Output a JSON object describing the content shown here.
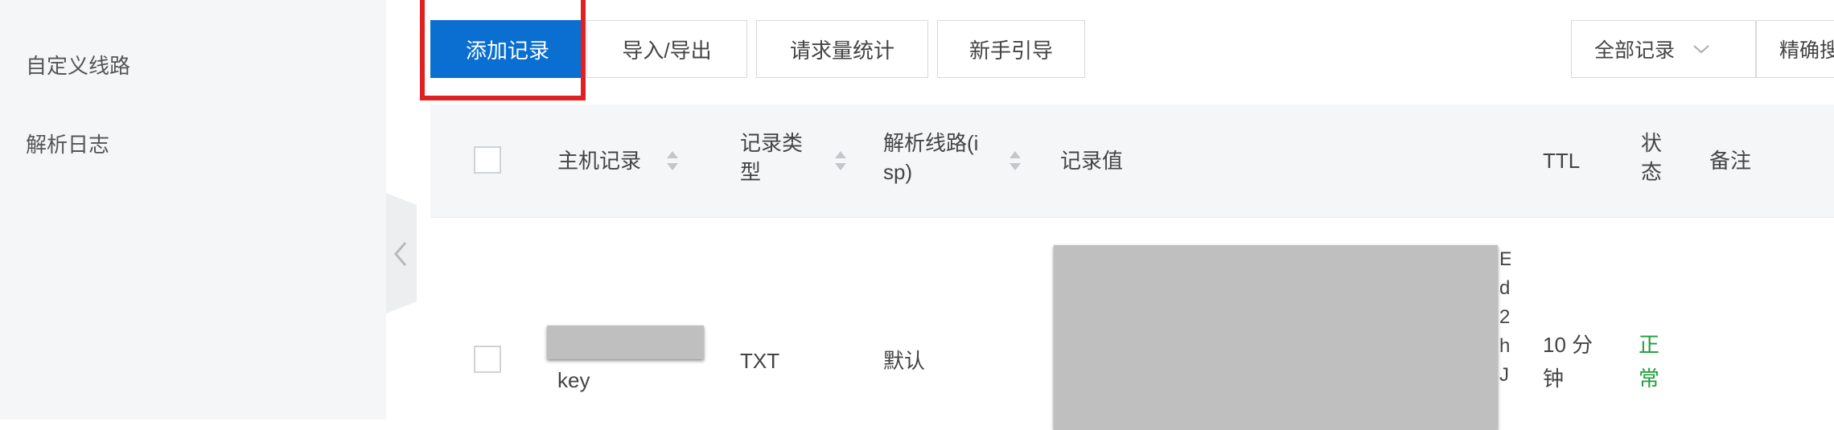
{
  "sidebar": {
    "items": [
      {
        "label": "自定义线路"
      },
      {
        "label": "解析日志"
      }
    ]
  },
  "toolbar": {
    "add_record": "添加记录",
    "import_export": "导入/导出",
    "request_stats": "请求量统计",
    "guide": "新手引导",
    "filter_select": "全部记录",
    "search_mode": "精确搜"
  },
  "table": {
    "headers": {
      "host": "主机记录",
      "type_l1": "记录类",
      "type_l2": "型",
      "line_l1": "解析线路(i",
      "line_l2": "sp)",
      "value": "记录值",
      "ttl": "TTL",
      "status_l1": "状",
      "status_l2": "态",
      "remark": "备注"
    },
    "rows": [
      {
        "host_suffix": "key",
        "type": "TXT",
        "line": "默认",
        "value_tail": [
          "E",
          "d",
          "2",
          "h",
          "J"
        ],
        "ttl_l1": "10 分",
        "ttl_l2": "钟",
        "status_l1": "正",
        "status_l2": "常"
      }
    ]
  },
  "colors": {
    "primary": "#0a6fd1",
    "highlight": "#e02121",
    "status_ok": "#1e9d3a"
  }
}
